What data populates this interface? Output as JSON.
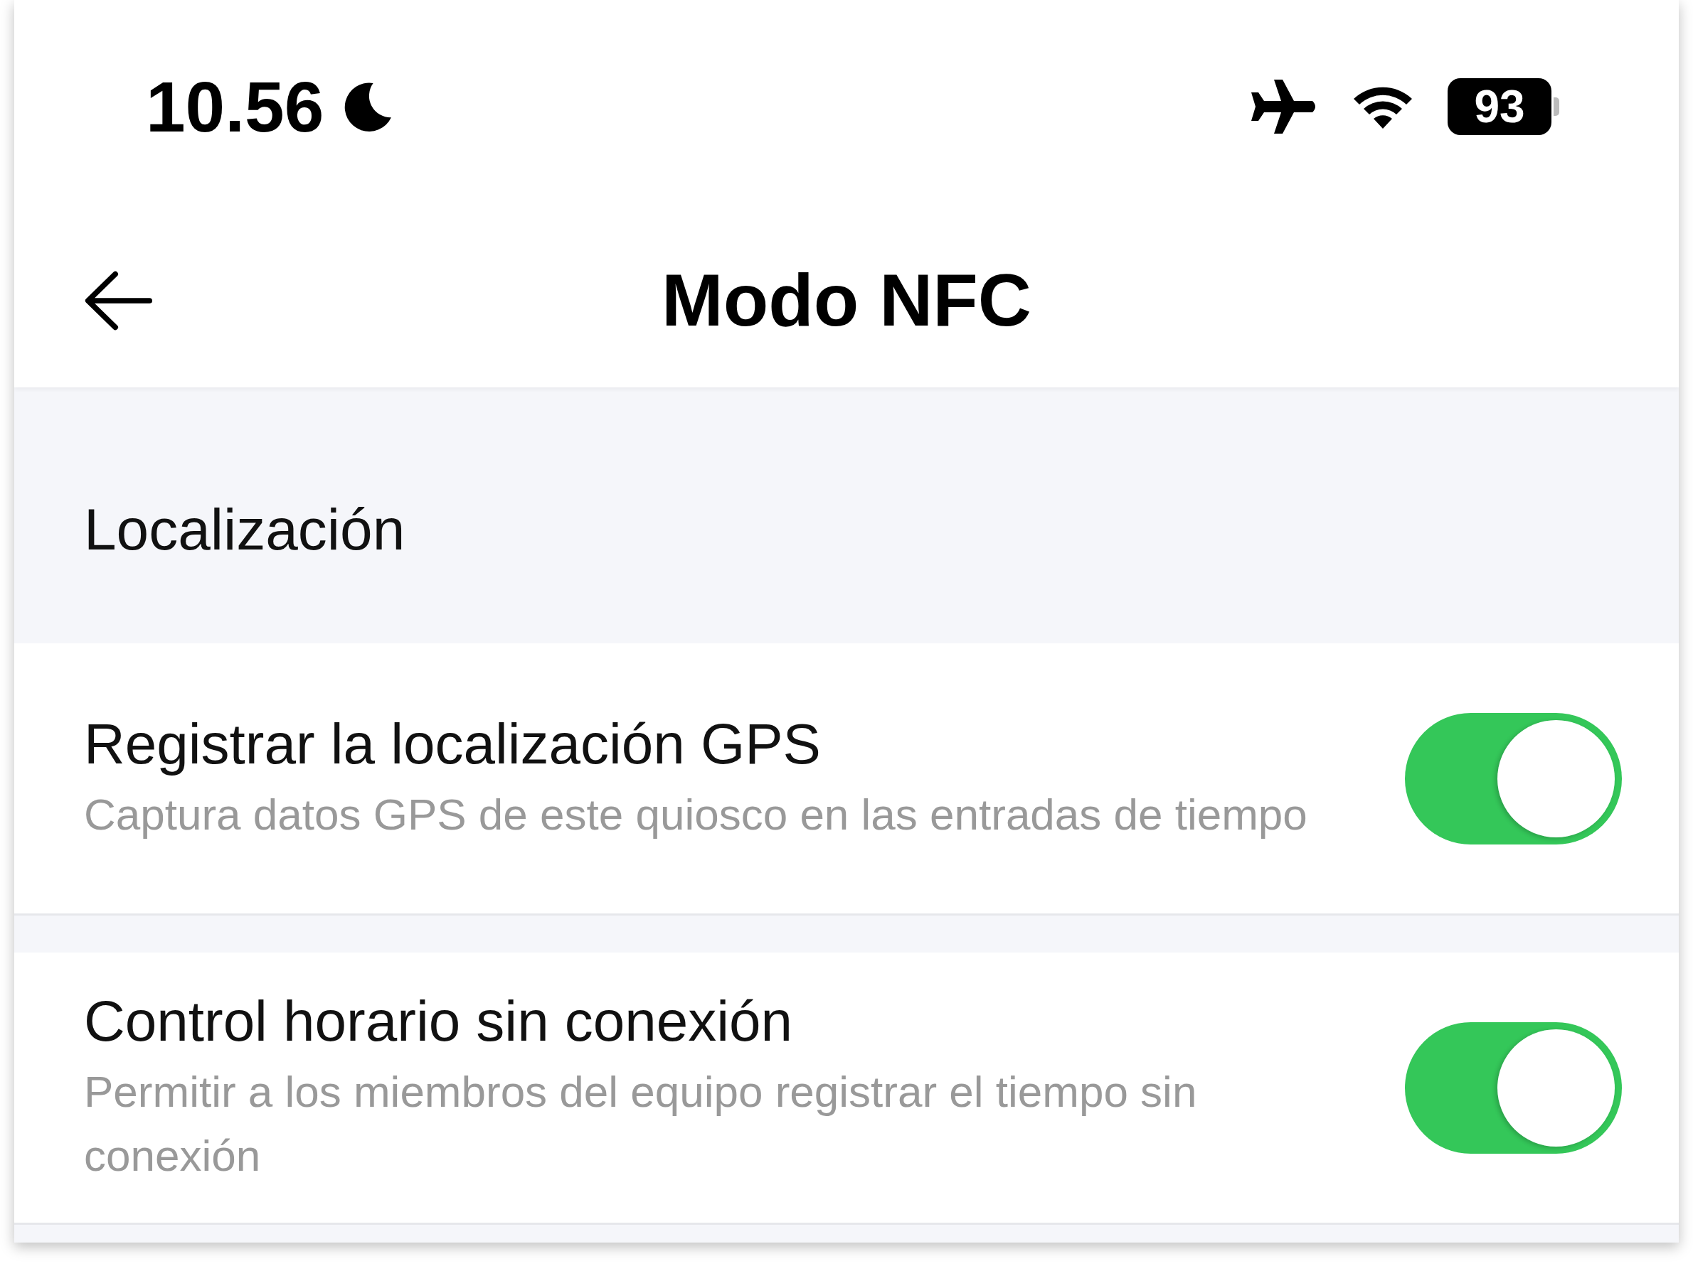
{
  "status_bar": {
    "time": "10.56",
    "battery": "93"
  },
  "header": {
    "title": "Modo NFC"
  },
  "section": {
    "title": "Localización"
  },
  "settings": [
    {
      "title": "Registrar la localización GPS",
      "description": "Captura datos GPS de este quiosco en las entradas de tiempo",
      "on": true
    },
    {
      "title": "Control horario sin conexión",
      "description": "Permitir a los miembros del equipo registrar el tiempo sin conexión",
      "on": true
    }
  ]
}
